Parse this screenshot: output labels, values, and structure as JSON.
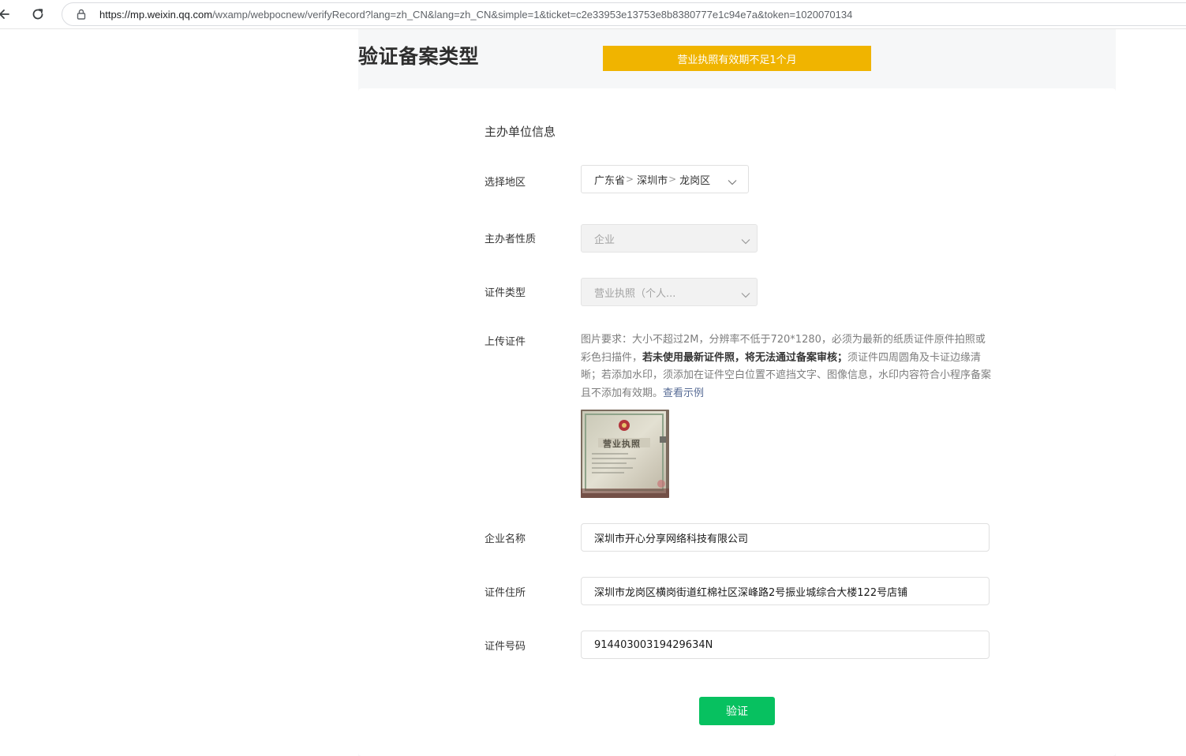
{
  "browser": {
    "url_host": "https://mp.weixin.qq.com",
    "url_path": "/wxamp/webpocnew/verifyRecord?lang=zh_CN&lang=zh_CN&simple=1&ticket=c2e33953e13753e8b8380777e1c94e7a&token=1020070134"
  },
  "page": {
    "title": "验证备案类型",
    "warning_banner": "营业执照有效期不足1个月"
  },
  "form": {
    "section_title": "主办单位信息",
    "region": {
      "label": "选择地区",
      "province": "广东省",
      "city": "深圳市",
      "district": "龙岗区",
      "separator": ">"
    },
    "organizer_type": {
      "label": "主办者性质",
      "value": "企业"
    },
    "certificate_type": {
      "label": "证件类型",
      "value": "营业执照（个人..."
    },
    "upload": {
      "label": "上传证件",
      "desc_part1": "图片要求：大小不超过2M，分辨率不低于720*1280，必须为最新的纸质证件原件拍照或彩色扫描件，",
      "desc_bold": "若未使用最新证件照，将无法通过备案审核；",
      "desc_part2": "须证件四周圆角及卡证边缘清晰；若添加水印，须添加在证件空白位置不遮挡文字、图像信息，水印内容符合小程序备案且不添加有效期。",
      "example_link": "查看示例",
      "thumbnail_text": "营业执照"
    },
    "company_name": {
      "label": "企业名称",
      "value": "深圳市开心分享网络科技有限公司"
    },
    "address": {
      "label": "证件住所",
      "value": "深圳市龙岗区横岗街道红棉社区深峰路2号振业城综合大楼122号店铺"
    },
    "license_number": {
      "label": "证件号码",
      "value": "91440300319429634N"
    },
    "submit_label": "验证"
  },
  "colors": {
    "primary_green": "#07c160",
    "warning_yellow": "#f0b400",
    "link_blue": "#576b95"
  }
}
